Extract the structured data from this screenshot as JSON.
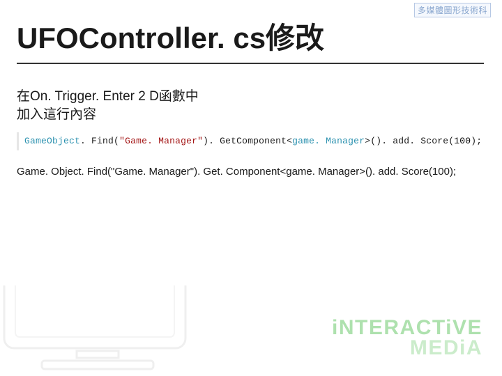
{
  "badge": {
    "text": "多媒體圖形技術科"
  },
  "title": "UFOController. cs修改",
  "body": {
    "line1": "在On. Trigger. Enter 2 D函數中",
    "line2": "加入這行內容"
  },
  "code_highlighted": {
    "t1": "GameObject",
    "t2": ". ",
    "t3": "Find",
    "t4": "(",
    "t5": "\"Game. Manager\"",
    "t6": "). ",
    "t7": "GetComponent",
    "t8": "<",
    "t9": "game. Manager",
    "t10": ">",
    "t11": "(). ",
    "t12": "add. Score",
    "t13": "(",
    "t14": "100",
    "t15": ");"
  },
  "code_plain": "Game. Object. Find(\"Game. Manager\"). Get. Component<game. Manager>(). add. Score(100);",
  "footer": {
    "line1": "iNTERACTiVE",
    "line2": "MEDiA"
  }
}
